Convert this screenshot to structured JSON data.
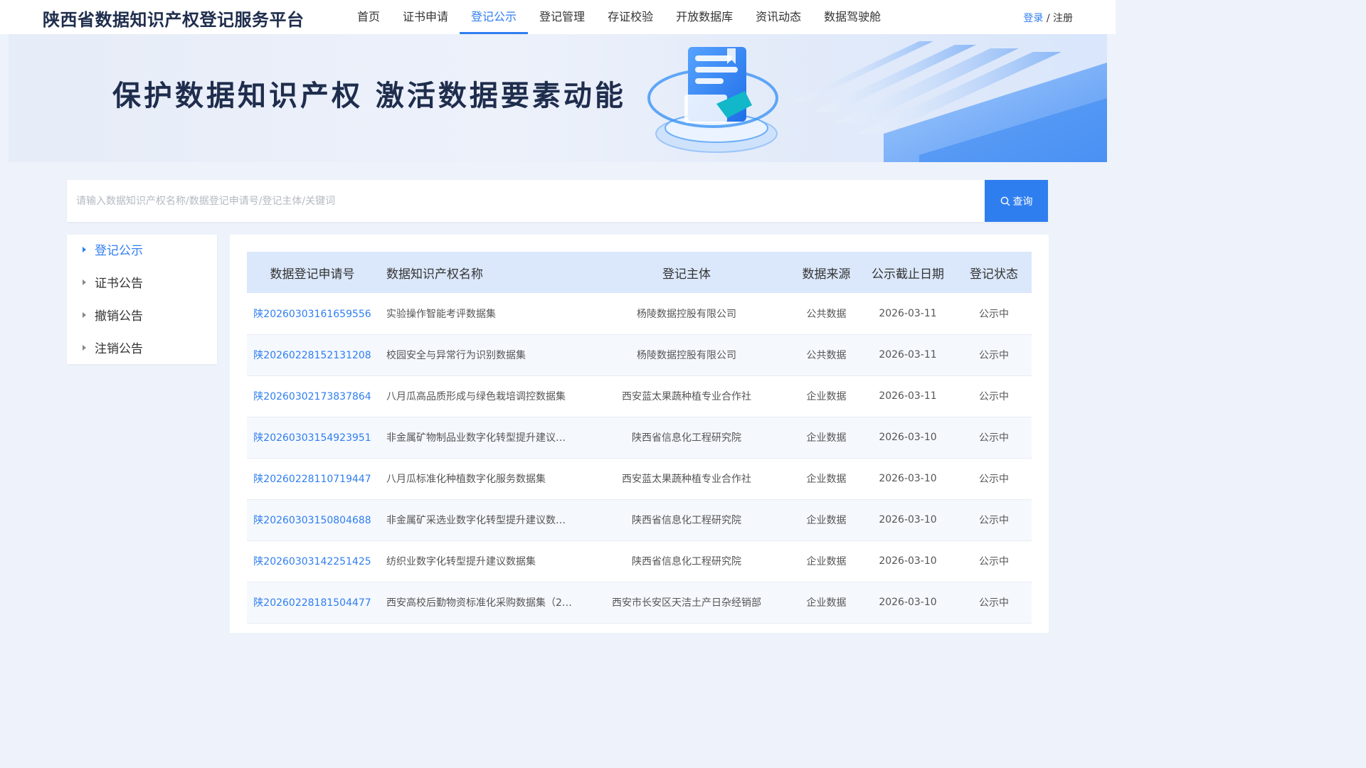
{
  "header": {
    "site_title": "陕西省数据知识产权登记服务平台",
    "nav": [
      "首页",
      "证书申请",
      "登记公示",
      "登记管理",
      "存证校验",
      "开放数据库",
      "资讯动态",
      "数据驾驶舱"
    ],
    "active_nav": "登记公示",
    "login_label": "登录",
    "separator": "/",
    "register_label": "注册"
  },
  "banner": {
    "slogan": "保护数据知识产权 激活数据要素动能"
  },
  "search": {
    "placeholder": "请输入数据知识产权名称/数据登记申请号/登记主体/关键词",
    "value": "",
    "button_label": "查询",
    "button_icon": "search-icon"
  },
  "sidebar": {
    "items": [
      "登记公示",
      "证书公告",
      "撤销公告",
      "注销公告"
    ],
    "active": "登记公示"
  },
  "table": {
    "headers": [
      "数据登记申请号",
      "数据知识产权名称",
      "登记主体",
      "数据来源",
      "公示截止日期",
      "登记状态"
    ],
    "rows": [
      [
        "陕20260303161659556",
        "实验操作智能考评数据集",
        "杨陵数据控股有限公司",
        "公共数据",
        "2026-03-11",
        "公示中"
      ],
      [
        "陕20260228152131208",
        "校园安全与异常行为识别数据集",
        "杨陵数据控股有限公司",
        "公共数据",
        "2026-03-11",
        "公示中"
      ],
      [
        "陕20260302173837864",
        "八月瓜高品质形成与绿色栽培调控数据集",
        "西安蓝太果蔬种植专业合作社",
        "企业数据",
        "2026-03-11",
        "公示中"
      ],
      [
        "陕20260303154923951",
        "非金属矿物制品业数字化转型提升建议…",
        "陕西省信息化工程研究院",
        "企业数据",
        "2026-03-10",
        "公示中"
      ],
      [
        "陕20260228110719447",
        "八月瓜标准化种植数字化服务数据集",
        "西安蓝太果蔬种植专业合作社",
        "企业数据",
        "2026-03-10",
        "公示中"
      ],
      [
        "陕20260303150804688",
        "非金属矿采选业数字化转型提升建议数…",
        "陕西省信息化工程研究院",
        "企业数据",
        "2026-03-10",
        "公示中"
      ],
      [
        "陕20260303142251425",
        "纺织业数字化转型提升建议数据集",
        "陕西省信息化工程研究院",
        "企业数据",
        "2026-03-10",
        "公示中"
      ],
      [
        "陕20260228181504477",
        "西安高校后勤物资标准化采购数据集（2…",
        "西安市长安区天洁土产日杂经销部",
        "企业数据",
        "2026-03-10",
        "公示中"
      ]
    ]
  },
  "colors": {
    "accent": "#2f7ef0",
    "title": "#1f2d4d",
    "table_header_bg": "#dbe8fb",
    "page_bg": "#eef3fb"
  }
}
